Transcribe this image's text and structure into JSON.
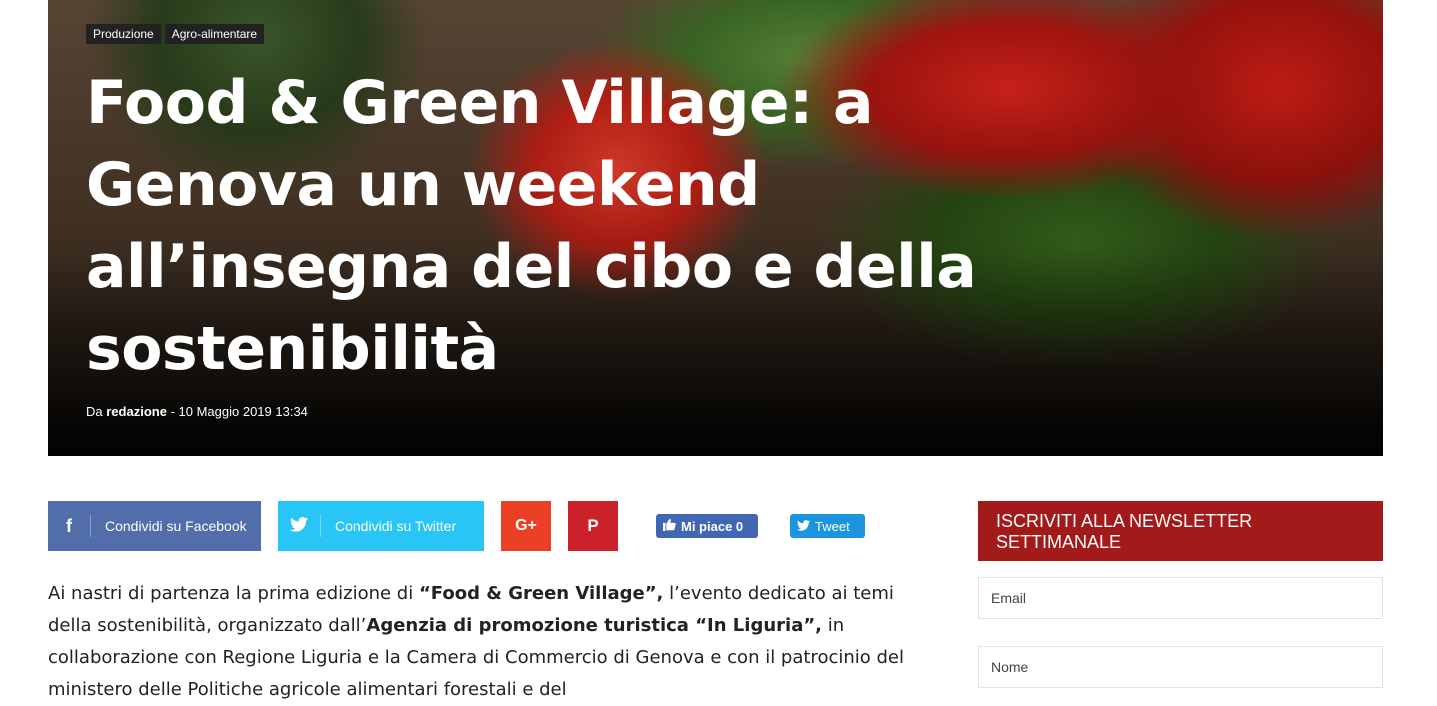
{
  "hero": {
    "tags": [
      "Produzione",
      "Agro-alimentare"
    ],
    "title": "Food & Green Village: a Genova un weekend all’insegna del cibo e della sostenibilità",
    "meta": {
      "by_label": "Da",
      "author": "redazione",
      "separator": "-",
      "date": "10 Maggio 2019 13:34"
    }
  },
  "share": {
    "facebook_label": "Condividi su Facebook",
    "twitter_label": "Condividi su Twitter",
    "facebook_icon": "facebook-icon",
    "twitter_icon": "twitter-icon",
    "googleplus_icon": "google-plus-icon",
    "pinterest_icon": "pinterest-icon",
    "like_label": "Mi piace",
    "like_count": "0",
    "tweet_label": "Tweet",
    "colors": {
      "facebook": "#516eab",
      "twitter": "#29c5f6",
      "googleplus": "#eb4026",
      "pinterest": "#ca212a"
    }
  },
  "article": {
    "p1": "Ai nastri di partenza la prima edizione di ",
    "b1": "“Food & Green Village”,",
    "p2": " l’evento dedicato ai temi della sostenibilità, organizzato dall’",
    "b2": "Agenzia di promozione turistica “In Liguria”,",
    "p3": " in collaborazione con Regione Liguria e la Camera di Commercio di Genova e con il patrocinio del ministero delle Politiche agricole alimentari forestali e del"
  },
  "sidebar": {
    "newsletter_title": "ISCRIVITI ALLA NEWSLETTER SETTIMANALE",
    "email_placeholder": "Email",
    "name_placeholder": "Nome",
    "accent_color": "#a31a1a"
  }
}
